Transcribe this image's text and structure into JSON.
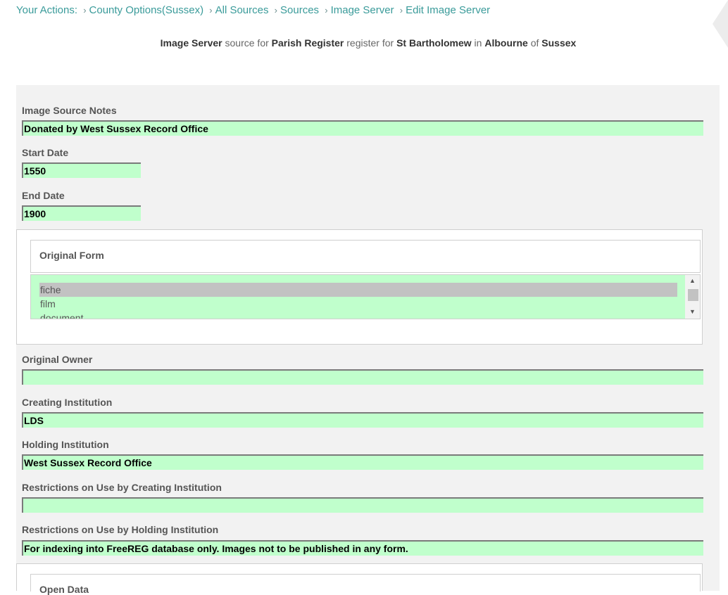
{
  "breadcrumb": {
    "prefix": "Your Actions:",
    "items": [
      "County Options(Sussex)",
      "All Sources",
      "Sources",
      "Image Server",
      "Edit Image Server"
    ],
    "separator": "›"
  },
  "heading": {
    "source": "Image Server",
    "t1": "source for",
    "register": "Parish Register",
    "t2": "register for",
    "church": "St Bartholomew",
    "t3": "in",
    "place": "Albourne",
    "t4": "of",
    "county": "Sussex"
  },
  "form": {
    "notes_label": "Image Source Notes",
    "notes_value": "Donated by West Sussex Record Office",
    "start_label": "Start Date",
    "start_value": "1550",
    "end_label": "End Date",
    "end_value": "1900",
    "original_form_legend": "Original Form",
    "original_form_options": [
      "fiche",
      "film",
      "document"
    ],
    "original_form_selected": "fiche",
    "owner_label": "Original Owner",
    "owner_value": "",
    "creating_label": "Creating Institution",
    "creating_value": "LDS",
    "holding_label": "Holding Institution",
    "holding_value": "West Sussex Record Office",
    "restr_creating_label": "Restrictions on Use by Creating Institution",
    "restr_creating_value": "",
    "restr_holding_label": "Restrictions on Use by Holding Institution",
    "restr_holding_value": "For indexing into FreeREG database only. Images not to be published in any form.",
    "open_data_legend": "Open Data"
  },
  "icons": {
    "scroll_up": "▲",
    "scroll_down": "▼"
  },
  "colors": {
    "link": "#3a9b9a",
    "field_bg": "#c0ffcc",
    "panel_bg": "#f2f2f2"
  }
}
